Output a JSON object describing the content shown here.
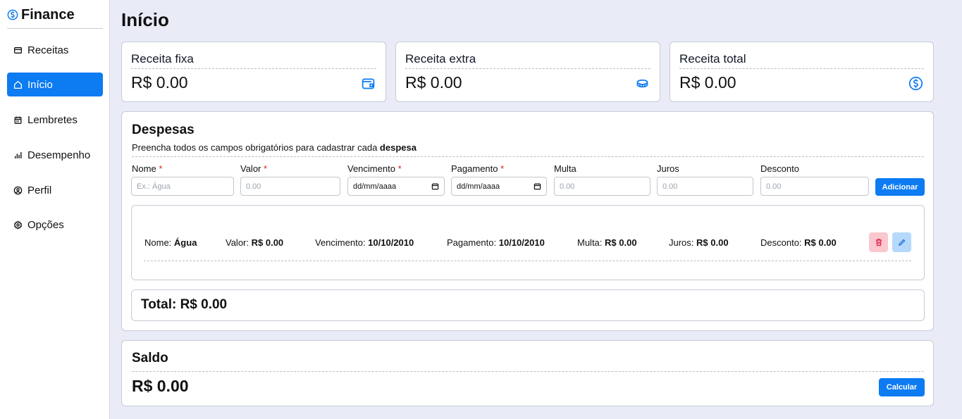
{
  "app": {
    "name": "Finance"
  },
  "sidebar": {
    "items": [
      {
        "label": "Receitas",
        "icon": "receipt-icon",
        "active": false
      },
      {
        "label": "Início",
        "icon": "home-icon",
        "active": true
      },
      {
        "label": "Lembretes",
        "icon": "calendar-icon",
        "active": false
      },
      {
        "label": "Desempenho",
        "icon": "bar-chart-icon",
        "active": false
      },
      {
        "label": "Perfil",
        "icon": "user-circle-icon",
        "active": false
      },
      {
        "label": "Opções",
        "icon": "gear-icon",
        "active": false
      }
    ]
  },
  "page": {
    "title": "Início"
  },
  "stats": [
    {
      "label": "Receita fixa",
      "value": "R$ 0.00",
      "icon": "wallet-icon"
    },
    {
      "label": "Receita extra",
      "value": "R$ 0.00",
      "icon": "coins-icon"
    },
    {
      "label": "Receita total",
      "value": "R$ 0.00",
      "icon": "dollar-circle-icon"
    }
  ],
  "expenses": {
    "title": "Despesas",
    "description_prefix": "Preencha todos os campos obrigatórios para cadastrar cada ",
    "description_bold": "despesa",
    "form": {
      "name": {
        "label": "Nome",
        "required": "*",
        "placeholder": "Ex.: Água"
      },
      "value": {
        "label": "Valor",
        "required": "*",
        "placeholder": "0.00"
      },
      "due": {
        "label": "Vencimento",
        "required": "*",
        "placeholder": "dd/mm/aaaa"
      },
      "payment": {
        "label": "Pagamento",
        "required": "*",
        "placeholder": "dd/mm/aaaa"
      },
      "fine": {
        "label": "Multa",
        "placeholder": "0.00"
      },
      "interest": {
        "label": "Juros",
        "placeholder": "0.00"
      },
      "discount": {
        "label": "Desconto",
        "placeholder": "0.00"
      },
      "add_label": "Adicionar"
    },
    "item": {
      "name_label": "Nome:",
      "name": "Água",
      "value_label": "Valor:",
      "value": "R$ 0.00",
      "due_label": "Vencimento:",
      "due": "10/10/2010",
      "payment_label": "Pagamento:",
      "payment": "10/10/2010",
      "fine_label": "Multa:",
      "fine": "R$ 0.00",
      "interest_label": "Juros:",
      "interest": "R$ 0.00",
      "discount_label": "Desconto:",
      "discount": "R$ 0.00"
    },
    "total": "Total: R$ 0.00"
  },
  "balance": {
    "title": "Saldo",
    "value": "R$ 0.00",
    "calculate_label": "Calcular"
  },
  "colors": {
    "accent": "#0d7bf2",
    "background": "#e9ecf7",
    "required": "#dc2626",
    "delete_bg": "#fbc8cf",
    "edit_bg": "#b6d8fb"
  }
}
